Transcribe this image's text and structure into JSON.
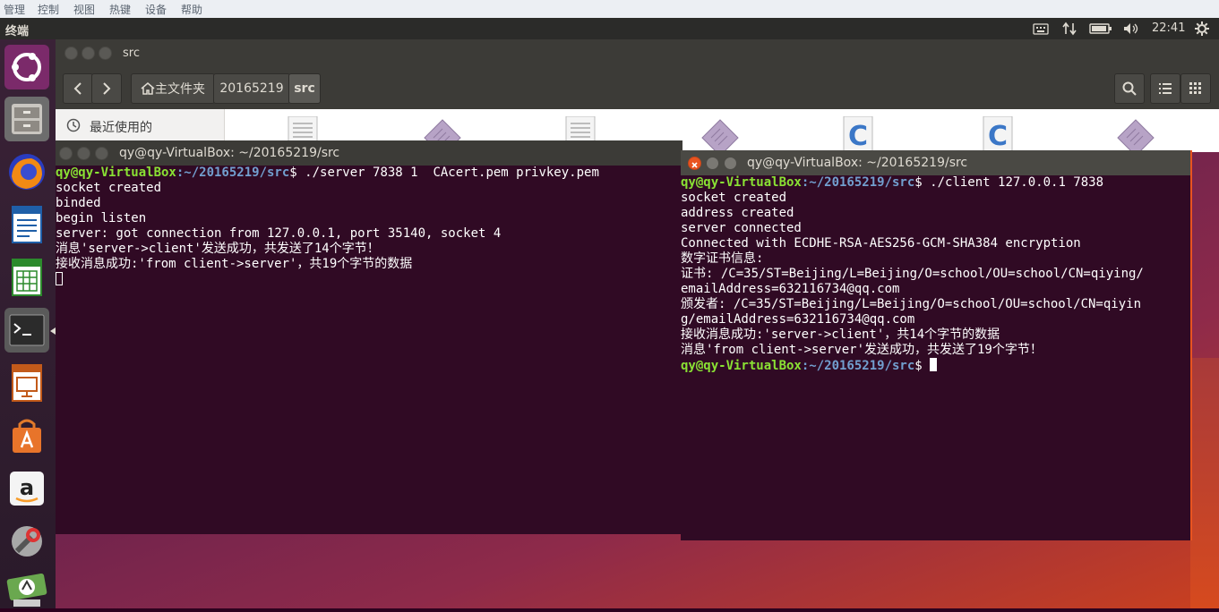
{
  "vbox_menu": [
    "管理",
    "控制",
    "视图",
    "热键",
    "设备",
    "帮助"
  ],
  "panel": {
    "title": "终端",
    "time": "22:41"
  },
  "file_manager": {
    "title": "src",
    "home_label": "主文件夹",
    "crumb_2": "20165219",
    "crumb_3": "src",
    "recent_label": "最近使用的"
  },
  "term_left": {
    "title": "qy@qy-VirtualBox: ~/20165219/src",
    "prompt_user": "qy@qy-VirtualBox",
    "prompt_path": ":~/20165219/src",
    "command": "$ ./server 7838 1  CAcert.pem privkey.pem",
    "lines": [
      "socket created",
      "binded",
      "begin listen",
      "server: got connection from 127.0.0.1, port 35140, socket 4",
      "消息'server->client'发送成功，共发送了14个字节！",
      "接收消息成功:'from client->server'，共19个字节的数据"
    ]
  },
  "term_right": {
    "title": "qy@qy-VirtualBox: ~/20165219/src",
    "prompt_user": "qy@qy-VirtualBox",
    "prompt_path": ":~/20165219/src",
    "command": "$ ./client 127.0.0.1 7838",
    "lines": [
      "socket created",
      "address created",
      "server connected",
      "Connected with ECDHE-RSA-AES256-GCM-SHA384 encryption",
      "数字证书信息:",
      "证书: /C=35/ST=Beijing/L=Beijing/O=school/OU=school/CN=qiying/",
      "emailAddress=632116734@qq.com",
      "颁发者: /C=35/ST=Beijing/L=Beijing/O=school/OU=school/CN=qiyin",
      "g/emailAddress=632116734@qq.com",
      "接收消息成功:'server->client'，共14个字节的数据",
      "消息'from client->server'发送成功，共发送了19个字节！"
    ],
    "final_prompt_suffix": "$ "
  },
  "colors": {
    "terminal_bg": "#300a24",
    "prompt_user": "#8ae234",
    "prompt_path": "#729fcf",
    "close_button": "#e95420"
  }
}
